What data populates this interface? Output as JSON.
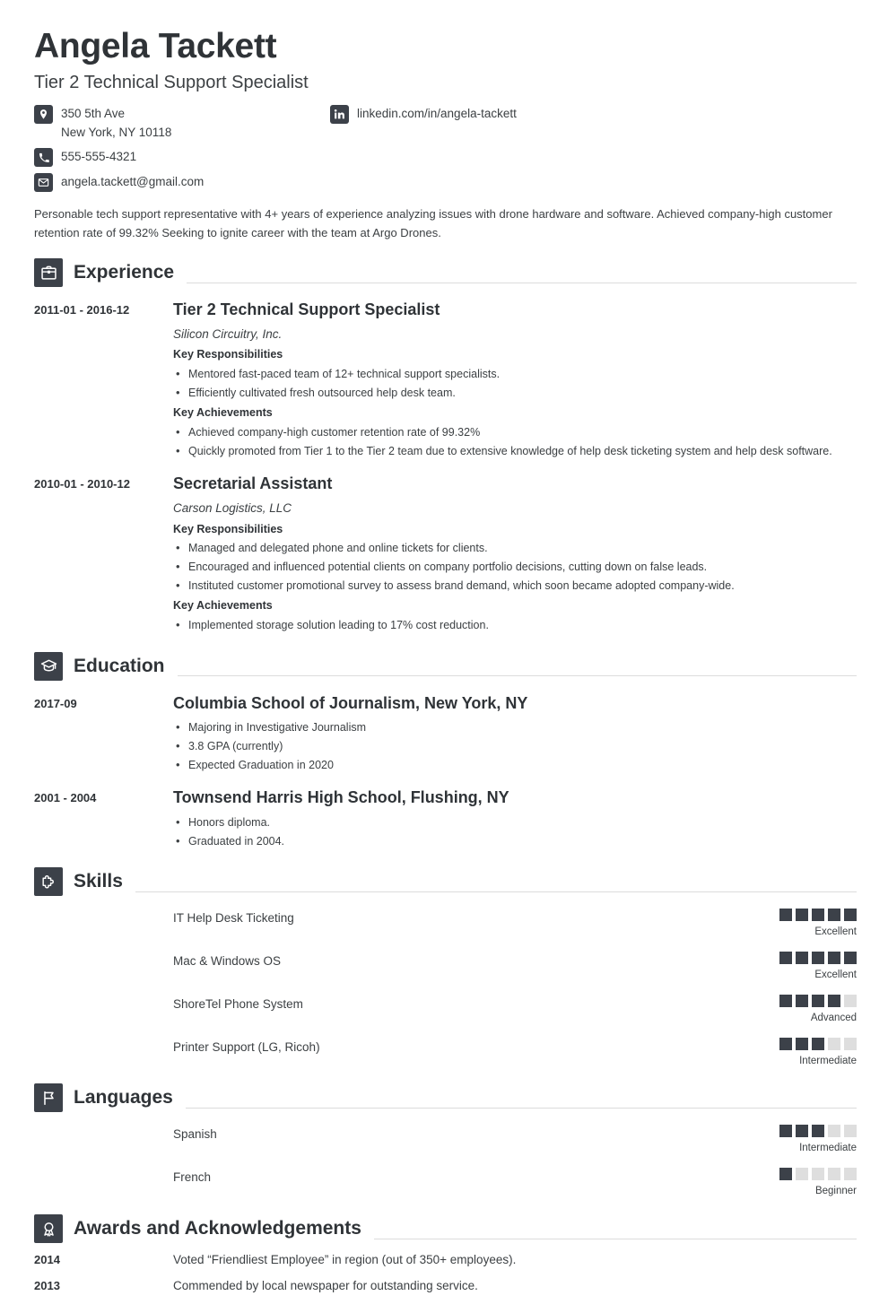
{
  "header": {
    "name": "Angela Tackett",
    "job_title": "Tier 2 Technical Support Specialist",
    "contacts": [
      {
        "icon": "location-pin-icon",
        "lines": [
          "350 5th Ave",
          "New York, NY 10118"
        ]
      },
      {
        "icon": "phone-icon",
        "lines": [
          "555-555-4321"
        ]
      },
      {
        "icon": "envelope-icon",
        "lines": [
          "angela.tackett@gmail.com"
        ]
      }
    ],
    "linkedin": {
      "icon": "linkedin-icon",
      "text": "linkedin.com/in/angela-tackett"
    }
  },
  "summary": "Personable tech support representative with 4+ years of experience analyzing issues with drone hardware and software. Achieved company-high customer retention rate of 99.32% Seeking to ignite career with the team at Argo Drones.",
  "sections": {
    "experience": {
      "icon": "briefcase-icon",
      "title": "Experience",
      "entries": [
        {
          "date": "2011-01 - 2016-12",
          "title": "Tier 2 Technical Support Specialist",
          "org": "Silicon Circuitry, Inc.",
          "groups": [
            {
              "heading": "Key Responsibilities",
              "items": [
                "Mentored fast-paced team of 12+ technical support specialists.",
                "Efficiently cultivated fresh outsourced help desk team."
              ]
            },
            {
              "heading": "Key Achievements",
              "items": [
                "Achieved company-high customer retention rate of 99.32%",
                "Quickly promoted from Tier 1 to the Tier 2 team due to extensive knowledge of help desk ticketing system and help desk software."
              ]
            }
          ]
        },
        {
          "date": "2010-01 - 2010-12",
          "title": "Secretarial Assistant",
          "org": "Carson Logistics, LLC",
          "groups": [
            {
              "heading": "Key Responsibilities",
              "items": [
                "Managed and delegated phone and online tickets for clients.",
                "Encouraged and influenced potential clients on company portfolio decisions, cutting down on false leads.",
                "Instituted customer promotional survey to assess brand demand, which soon became adopted company-wide."
              ]
            },
            {
              "heading": "Key Achievements",
              "items": [
                "Implemented storage solution leading to 17% cost reduction."
              ]
            }
          ]
        }
      ]
    },
    "education": {
      "icon": "graduation-cap-icon",
      "title": "Education",
      "entries": [
        {
          "date": "2017-09",
          "title": "Columbia School of Journalism, New York, NY",
          "org": "",
          "groups": [
            {
              "heading": "",
              "items": [
                "Majoring in Investigative Journalism",
                "3.8 GPA (currently)",
                "Expected Graduation in 2020"
              ]
            }
          ]
        },
        {
          "date": "2001 - 2004",
          "title": "Townsend Harris High School, Flushing, NY",
          "org": "",
          "groups": [
            {
              "heading": "",
              "items": [
                "Honors diploma.",
                "Graduated in 2004."
              ]
            }
          ]
        }
      ]
    },
    "skills": {
      "icon": "puzzle-piece-icon",
      "title": "Skills",
      "max_rating": 5,
      "items": [
        {
          "label": "IT Help Desk Ticketing",
          "rating": 5,
          "level": "Excellent"
        },
        {
          "label": "Mac & Windows OS",
          "rating": 5,
          "level": "Excellent"
        },
        {
          "label": "ShoreTel Phone System",
          "rating": 4,
          "level": "Advanced"
        },
        {
          "label": "Printer Support (LG, Ricoh)",
          "rating": 3,
          "level": "Intermediate"
        }
      ]
    },
    "languages": {
      "icon": "flag-icon",
      "title": "Languages",
      "max_rating": 5,
      "items": [
        {
          "label": "Spanish",
          "rating": 3,
          "level": "Intermediate"
        },
        {
          "label": "French",
          "rating": 1,
          "level": "Beginner"
        }
      ]
    },
    "awards": {
      "icon": "award-ribbon-icon",
      "title": "Awards and Acknowledgements",
      "items": [
        {
          "year": "2014",
          "text": "Voted “Friendliest Employee” in region (out of 350+ employees)."
        },
        {
          "year": "2013",
          "text": "Commended by local newspaper for outstanding service."
        }
      ]
    }
  },
  "colors": {
    "icon_background": "#3c4149",
    "text": "#3c4043",
    "heading": "#2f3337",
    "rule": "#dcdcdc",
    "dot_empty": "#dedede"
  }
}
